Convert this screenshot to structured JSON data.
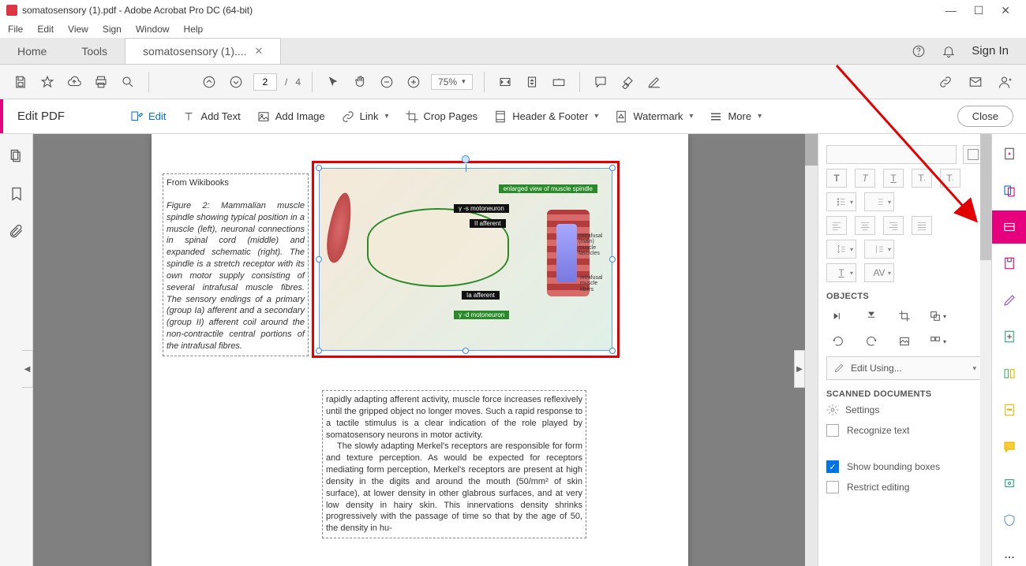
{
  "window": {
    "title": "somatosensory (1).pdf - Adobe Acrobat Pro DC (64-bit)"
  },
  "menu": [
    "File",
    "Edit",
    "View",
    "Sign",
    "Window",
    "Help"
  ],
  "tabs": {
    "home": "Home",
    "tools": "Tools",
    "doc": "somatosensory (1)....",
    "signin": "Sign In"
  },
  "maintoolbar": {
    "page_current": "2",
    "page_sep": "/",
    "page_total": "4",
    "zoom": "75%"
  },
  "editbar": {
    "title": "Edit PDF",
    "edit": "Edit",
    "addtext": "Add Text",
    "addimage": "Add Image",
    "link": "Link",
    "crop": "Crop Pages",
    "header": "Header & Footer",
    "watermark": "Watermark",
    "more": "More",
    "close": "Close"
  },
  "doc": {
    "from": "From Wikibooks",
    "figcaption": "Figure 2: Mammalian muscle spindle showing typical position in a muscle (left), neuronal connections in spinal cord (middle) and expanded schematic (right). The spindle is a stretch receptor with its own motor supply consisting of several intrafusal muscle fibres. The sensory endings of a primary (group Ia) afferent and a secondary (group II) afferent coil around the non-contractile central portions of the intrafusal fibres.",
    "image_labels": {
      "enlarged": "enlarged view of muscle spindle",
      "gs": "γ -s motoneuron",
      "ii": "II afferent",
      "ia": "Ia afferent",
      "gd": "γ -d motoneuron",
      "extra": "extrafusal\n(main)\nmuscle\nfascicles",
      "intra": "intrafusal\nmuscle\nfibers"
    },
    "body2a": "rapidly adapting afferent activity, muscle force increases reflexively until the gripped object no longer moves. Such a rapid response to a tactile stimulus is a clear indication of the role played by somatosensory neurons in motor activity.",
    "body2b": "The slowly adapting Merkel's receptors are responsible for form and texture perception. As would be expected for receptors mediating form perception, Merkel's receptors are present at high density in the digits and around the mouth (50/mm² of skin surface), at lower density in other glabrous surfaces, and at very low density in hairy skin. This innervations density shrinks progressively with the passage of time so that by the age of 50, the density in hu-"
  },
  "format_panel": {
    "objects": "OBJECTS",
    "editusing": "Edit Using...",
    "scanned": "SCANNED DOCUMENTS",
    "settings": "Settings",
    "recognize": "Recognize text",
    "showboxes": "Show bounding boxes",
    "restrict": "Restrict editing"
  },
  "icons": {
    "T": "T",
    "Ti": "T",
    "AV": "AV"
  }
}
